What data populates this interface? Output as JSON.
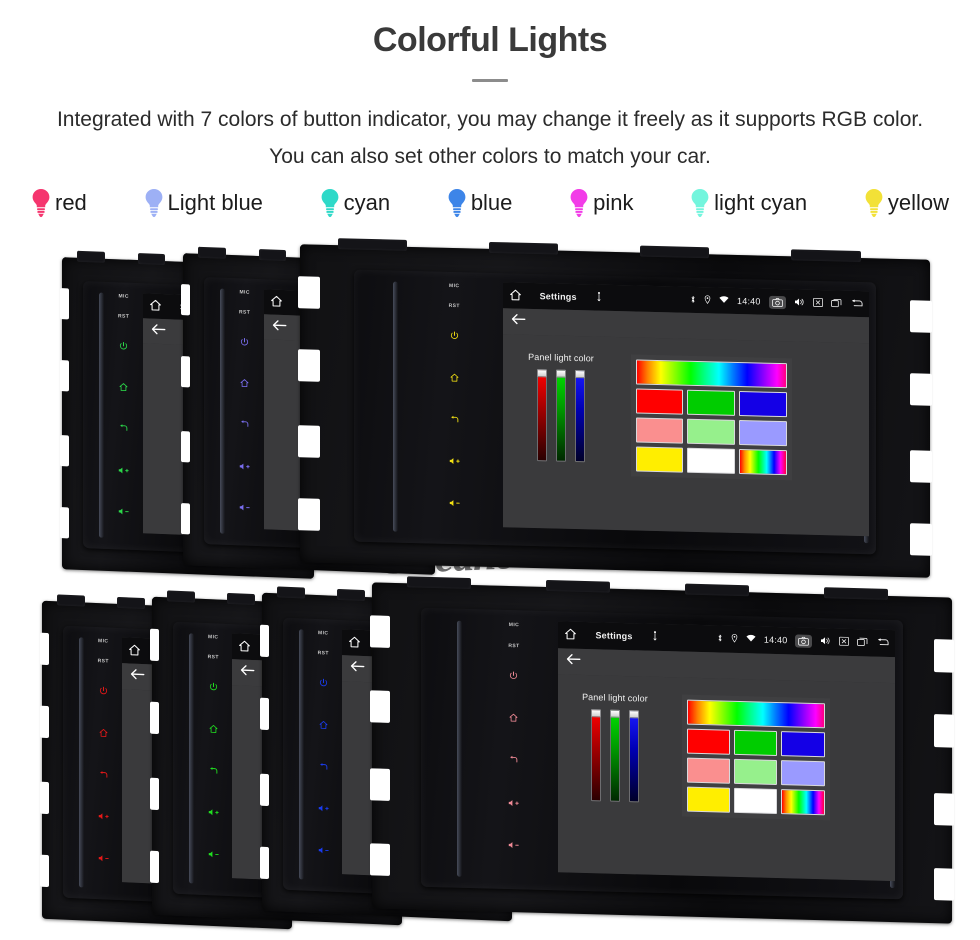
{
  "header": {
    "title": "Colorful Lights",
    "subtitle": "Integrated with 7 colors of button indicator, you may change it freely as it supports RGB color. You can also set other colors to match your car."
  },
  "legend": {
    "items": [
      {
        "label": "red",
        "color": "#f5356e",
        "icon": "bulb-icon"
      },
      {
        "label": "Light blue",
        "color": "#9db0f5",
        "icon": "bulb-icon"
      },
      {
        "label": "cyan",
        "color": "#2ed9c8",
        "icon": "bulb-icon"
      },
      {
        "label": "blue",
        "color": "#3d85e8",
        "icon": "bulb-icon"
      },
      {
        "label": "pink",
        "color": "#f23ce8",
        "icon": "bulb-icon"
      },
      {
        "label": "light cyan",
        "color": "#73f5dd",
        "icon": "bulb-icon"
      },
      {
        "label": "yellow",
        "color": "#f2e137",
        "icon": "bulb-icon"
      }
    ]
  },
  "device": {
    "strip_labels": {
      "mic": "MIC",
      "rst": "RST"
    },
    "strip_icons": [
      "power-icon",
      "home-icon",
      "back-icon",
      "volume-up-icon",
      "volume-down-icon"
    ],
    "statusbar": {
      "home_icon": "home-icon",
      "title": "Settings",
      "usb_icon": "usb-icon",
      "bluetooth_icon": "bluetooth-icon",
      "location_icon": "location-icon",
      "wifi_icon": "wifi-icon",
      "clock": "14:40",
      "camera_icon": "camera-icon",
      "volume_icon": "volume-icon",
      "close_icon": "close-box-icon",
      "recents_icon": "recents-icon",
      "back_icon": "back-arrow-icon"
    },
    "subbar": {
      "back_icon": "back-arrow-icon"
    },
    "picker": {
      "label": "Panel light color",
      "sliders": [
        {
          "name": "red-slider",
          "color": "#ff0000"
        },
        {
          "name": "green-slider",
          "color": "#00e000"
        },
        {
          "name": "blue-slider",
          "color": "#1a1aff"
        }
      ],
      "swatches": [
        {
          "name": "spectrum-bar",
          "color": "spectrum"
        },
        {
          "name": "swatch-red",
          "color": "#ff0000"
        },
        {
          "name": "swatch-green",
          "color": "#00cc00"
        },
        {
          "name": "swatch-blue",
          "color": "#1400e6"
        },
        {
          "name": "swatch-salmon",
          "color": "#fa8f8f"
        },
        {
          "name": "swatch-lightgreen",
          "color": "#96f08c"
        },
        {
          "name": "swatch-periwinkle",
          "color": "#9a9aff"
        },
        {
          "name": "swatch-yellow",
          "color": "#ffee00"
        },
        {
          "name": "swatch-white",
          "color": "#ffffff"
        },
        {
          "name": "swatch-rainbow",
          "color": "spectrum-sm"
        }
      ]
    }
  },
  "rows": {
    "top": {
      "units": [
        {
          "name": "unit-green",
          "led": "#2bd94a"
        },
        {
          "name": "unit-violet",
          "led": "#7a6ef0"
        },
        {
          "name": "unit-yellow",
          "led": "#f2e013"
        }
      ]
    },
    "bottom": {
      "units": [
        {
          "name": "unit-red",
          "led": "#e81818"
        },
        {
          "name": "unit-green",
          "led": "#20e020"
        },
        {
          "name": "unit-blue",
          "led": "#1a3cf0"
        },
        {
          "name": "unit-pink",
          "led": "#f08a96"
        }
      ]
    }
  },
  "watermark": {
    "text": "Seicane"
  }
}
